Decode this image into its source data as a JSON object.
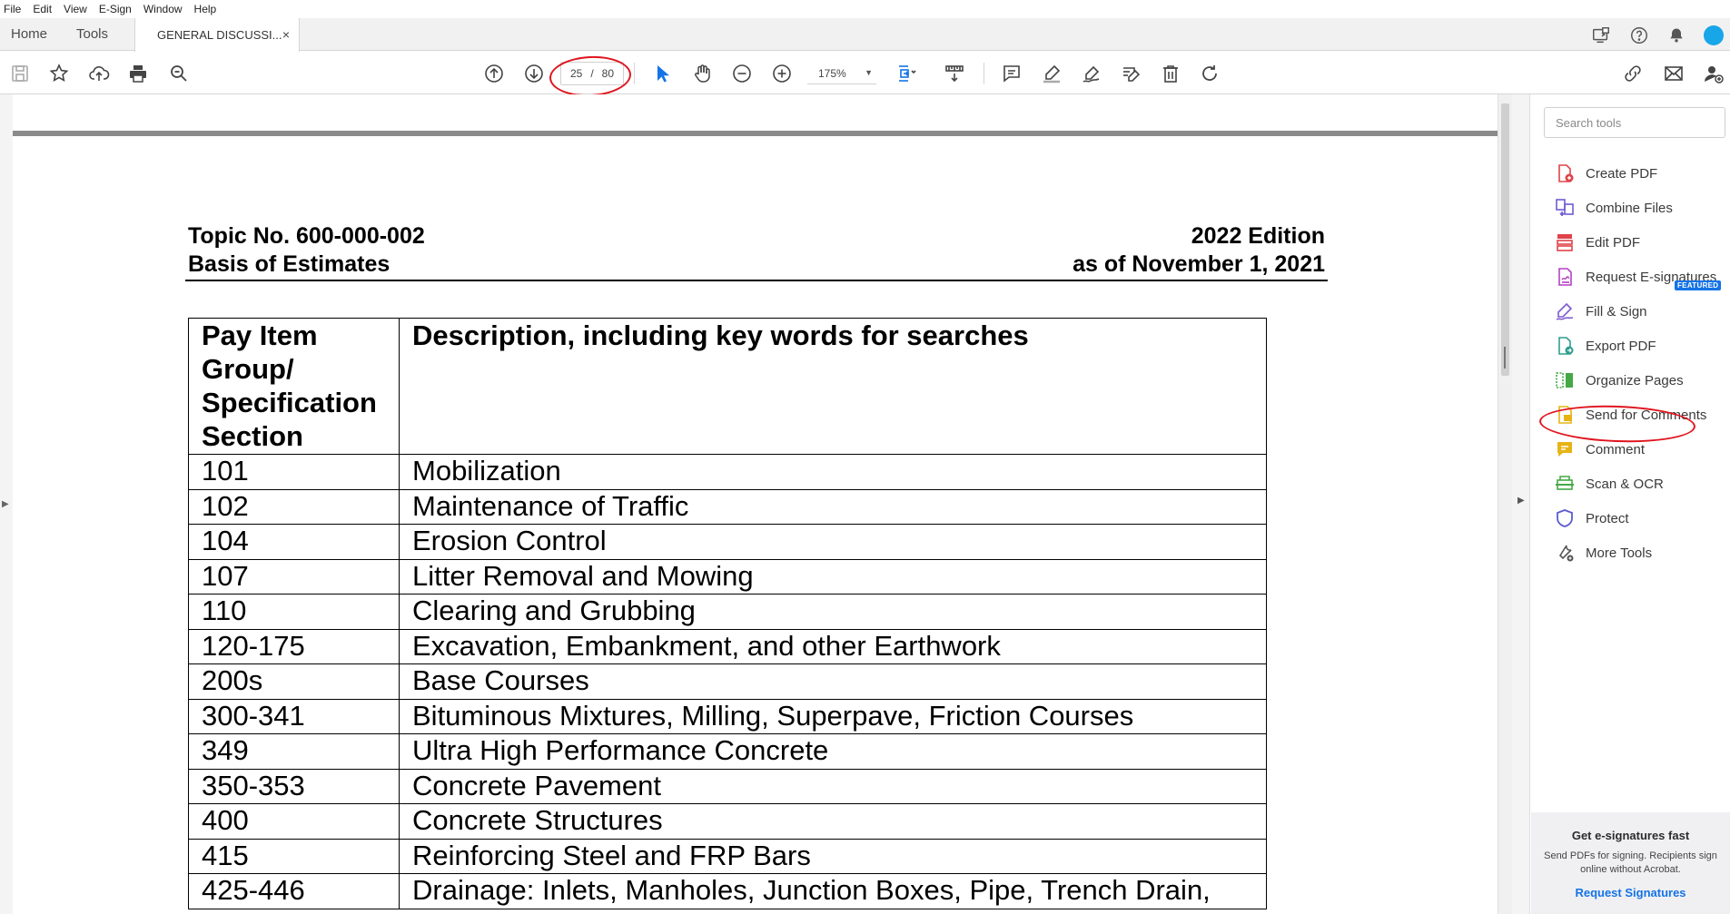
{
  "menu": [
    "File",
    "Edit",
    "View",
    "E-Sign",
    "Window",
    "Help"
  ],
  "tabs": {
    "home": "Home",
    "tools": "Tools",
    "document": "GENERAL DISCUSSI...",
    "close_glyph": "×"
  },
  "toolbar": {
    "page_current": "25",
    "page_separator": "/",
    "page_total": "80",
    "zoom": "175%"
  },
  "document": {
    "header_left_line1": "Topic No. 600-000-002",
    "header_left_line2": "Basis of Estimates",
    "header_right_line1": "2022 Edition",
    "header_right_line2": "as of November 1, 2021",
    "table": {
      "col1_header": "Pay Item Group/ Specification Section",
      "col2_header": "Description, including key words for searches",
      "rows": [
        [
          "101",
          "Mobilization"
        ],
        [
          "102",
          "Maintenance of Traffic"
        ],
        [
          "104",
          "Erosion Control"
        ],
        [
          "107",
          "Litter Removal and Mowing"
        ],
        [
          "110",
          "Clearing and Grubbing"
        ],
        [
          "120-175",
          "Excavation, Embankment, and other Earthwork"
        ],
        [
          "200s",
          "Base Courses"
        ],
        [
          "300-341",
          "Bituminous Mixtures, Milling, Superpave, Friction Courses"
        ],
        [
          "349",
          "Ultra High Performance Concrete"
        ],
        [
          "350-353",
          "Concrete Pavement"
        ],
        [
          "400",
          "Concrete Structures"
        ],
        [
          "415",
          "Reinforcing Steel and FRP Bars"
        ],
        [
          "425-446",
          "Drainage: Inlets, Manholes, Junction Boxes, Pipe, Trench Drain,"
        ]
      ]
    }
  },
  "tools_panel": {
    "search_placeholder": "Search tools",
    "featured_badge": "FEATURED",
    "items": [
      {
        "label": "Create PDF",
        "icon": "create-pdf-icon",
        "color": "#e0434a"
      },
      {
        "label": "Combine Files",
        "icon": "combine-files-icon",
        "color": "#6d5bd0"
      },
      {
        "label": "Edit PDF",
        "icon": "edit-pdf-icon",
        "color": "#e0434a"
      },
      {
        "label": "Request E-signatures",
        "icon": "request-esign-icon",
        "color": "#b640c4"
      },
      {
        "label": "Fill & Sign",
        "icon": "fill-sign-icon",
        "color": "#7b5bd0"
      },
      {
        "label": "Export PDF",
        "icon": "export-pdf-icon",
        "color": "#2f9e8f"
      },
      {
        "label": "Organize Pages",
        "icon": "organize-pages-icon",
        "color": "#45a847"
      },
      {
        "label": "Send for Comments",
        "icon": "send-comments-icon",
        "color": "#e7b416"
      },
      {
        "label": "Comment",
        "icon": "comment-icon",
        "color": "#e7b416"
      },
      {
        "label": "Scan & OCR",
        "icon": "scan-ocr-icon",
        "color": "#45a847"
      },
      {
        "label": "Protect",
        "icon": "protect-icon",
        "color": "#5b5bd0"
      },
      {
        "label": "More Tools",
        "icon": "more-tools-icon",
        "color": "#555555"
      }
    ],
    "promo": {
      "title": "Get e-signatures fast",
      "body": "Send PDFs for signing. Recipients sign online without Acrobat.",
      "link": "Request Signatures"
    }
  },
  "colors": {
    "accent": "#1473e6",
    "annotation_red": "#e0141e"
  }
}
